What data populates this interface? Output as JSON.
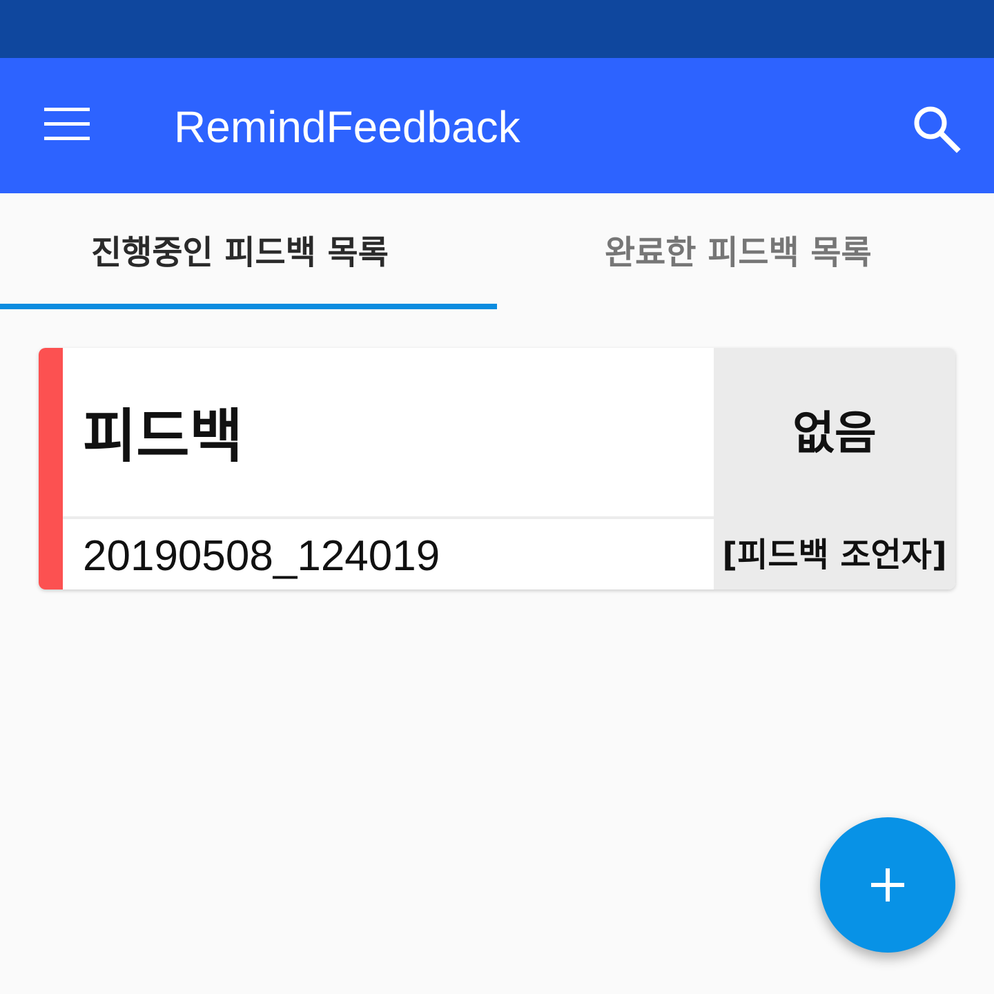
{
  "app_bar": {
    "title": "RemindFeedback",
    "menu_icon": "hamburger-menu-icon",
    "search_icon": "search-icon"
  },
  "tabs": [
    {
      "label": "진행중인 피드백 목록",
      "active": true
    },
    {
      "label": "완료한 피드백 목록",
      "active": false
    }
  ],
  "feedback_list": [
    {
      "title": "피드백",
      "date": "20190508_124019",
      "status": "없음",
      "advisor": "[피드백 조언자]",
      "accent_color": "#fc5151"
    }
  ],
  "fab": {
    "icon": "plus-icon"
  },
  "colors": {
    "status_bar": "#0f479e",
    "app_bar": "#2d63ff",
    "tab_indicator": "#0b8ce0",
    "fab": "#0892e6",
    "background": "#fafafa"
  }
}
